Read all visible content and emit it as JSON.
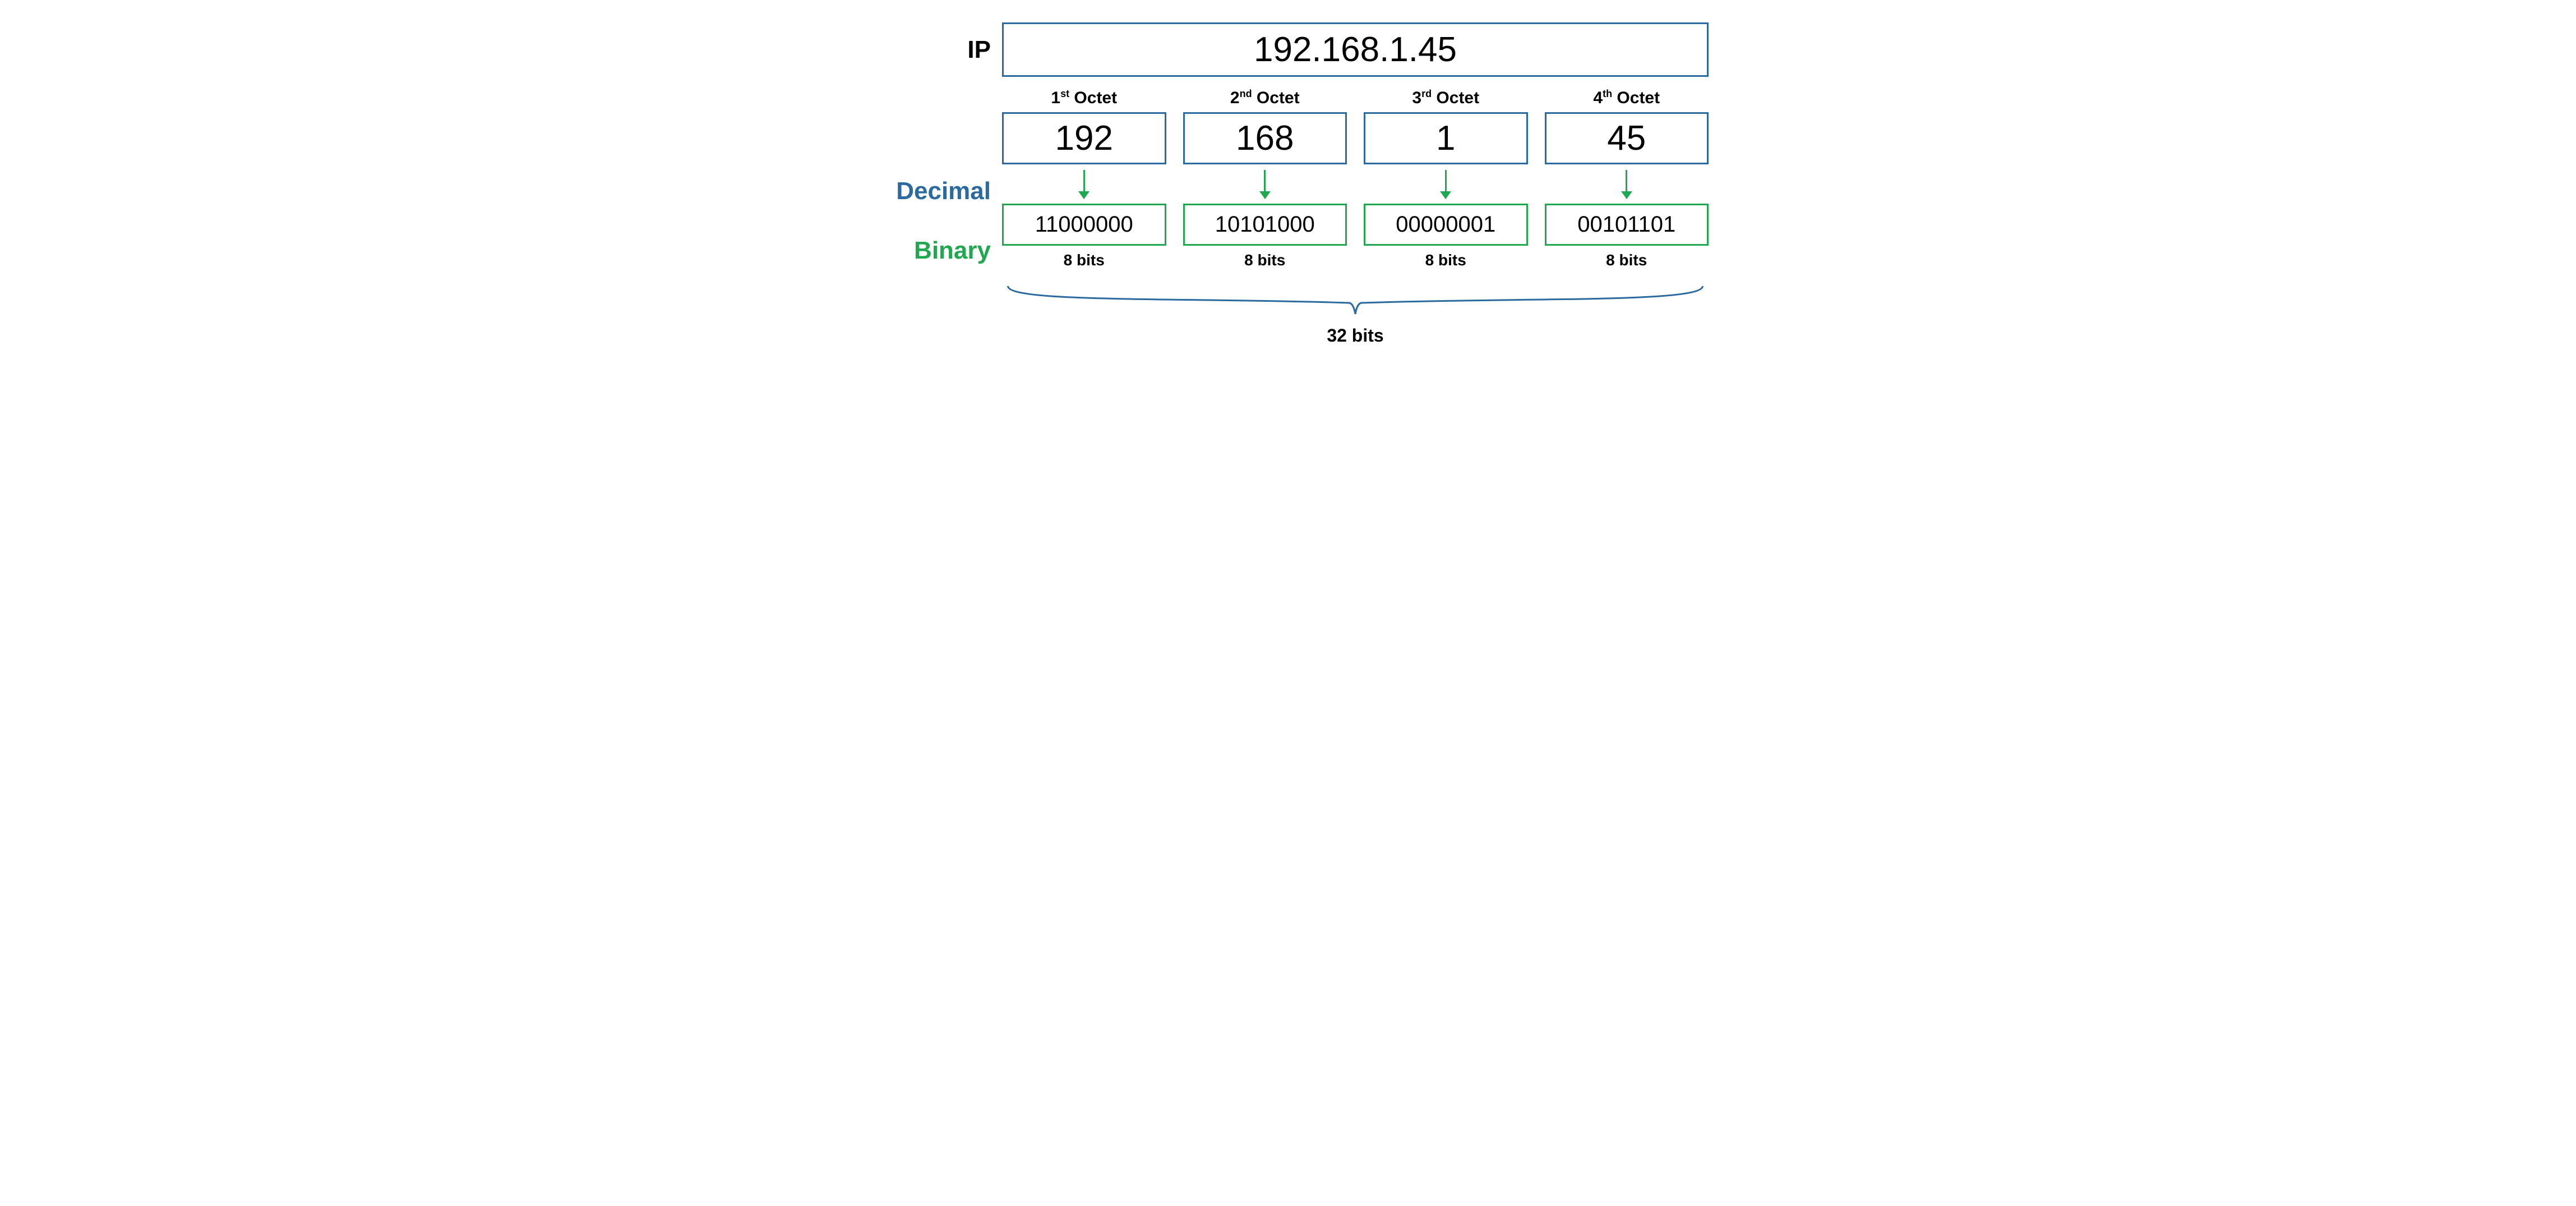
{
  "labels": {
    "ip": "IP",
    "decimal": "Decimal",
    "binary": "Binary"
  },
  "ip_address": "192.168.1.45",
  "octets": [
    {
      "ordinal": "1",
      "suffix": "st",
      "header_word": "Octet",
      "decimal": "192",
      "binary": "11000000",
      "bits_label": "8 bits"
    },
    {
      "ordinal": "2",
      "suffix": "nd",
      "header_word": "Octet",
      "decimal": "168",
      "binary": "10101000",
      "bits_label": "8 bits"
    },
    {
      "ordinal": "3",
      "suffix": "rd",
      "header_word": "Octet",
      "decimal": "1",
      "binary": "00000001",
      "bits_label": "8 bits"
    },
    {
      "ordinal": "4",
      "suffix": "th",
      "header_word": "Octet",
      "decimal": "45",
      "binary": "00101101",
      "bits_label": "8 bits"
    }
  ],
  "total_bits": "32 bits",
  "colors": {
    "blue": "#2b6a9e",
    "green": "#1fa84f"
  }
}
